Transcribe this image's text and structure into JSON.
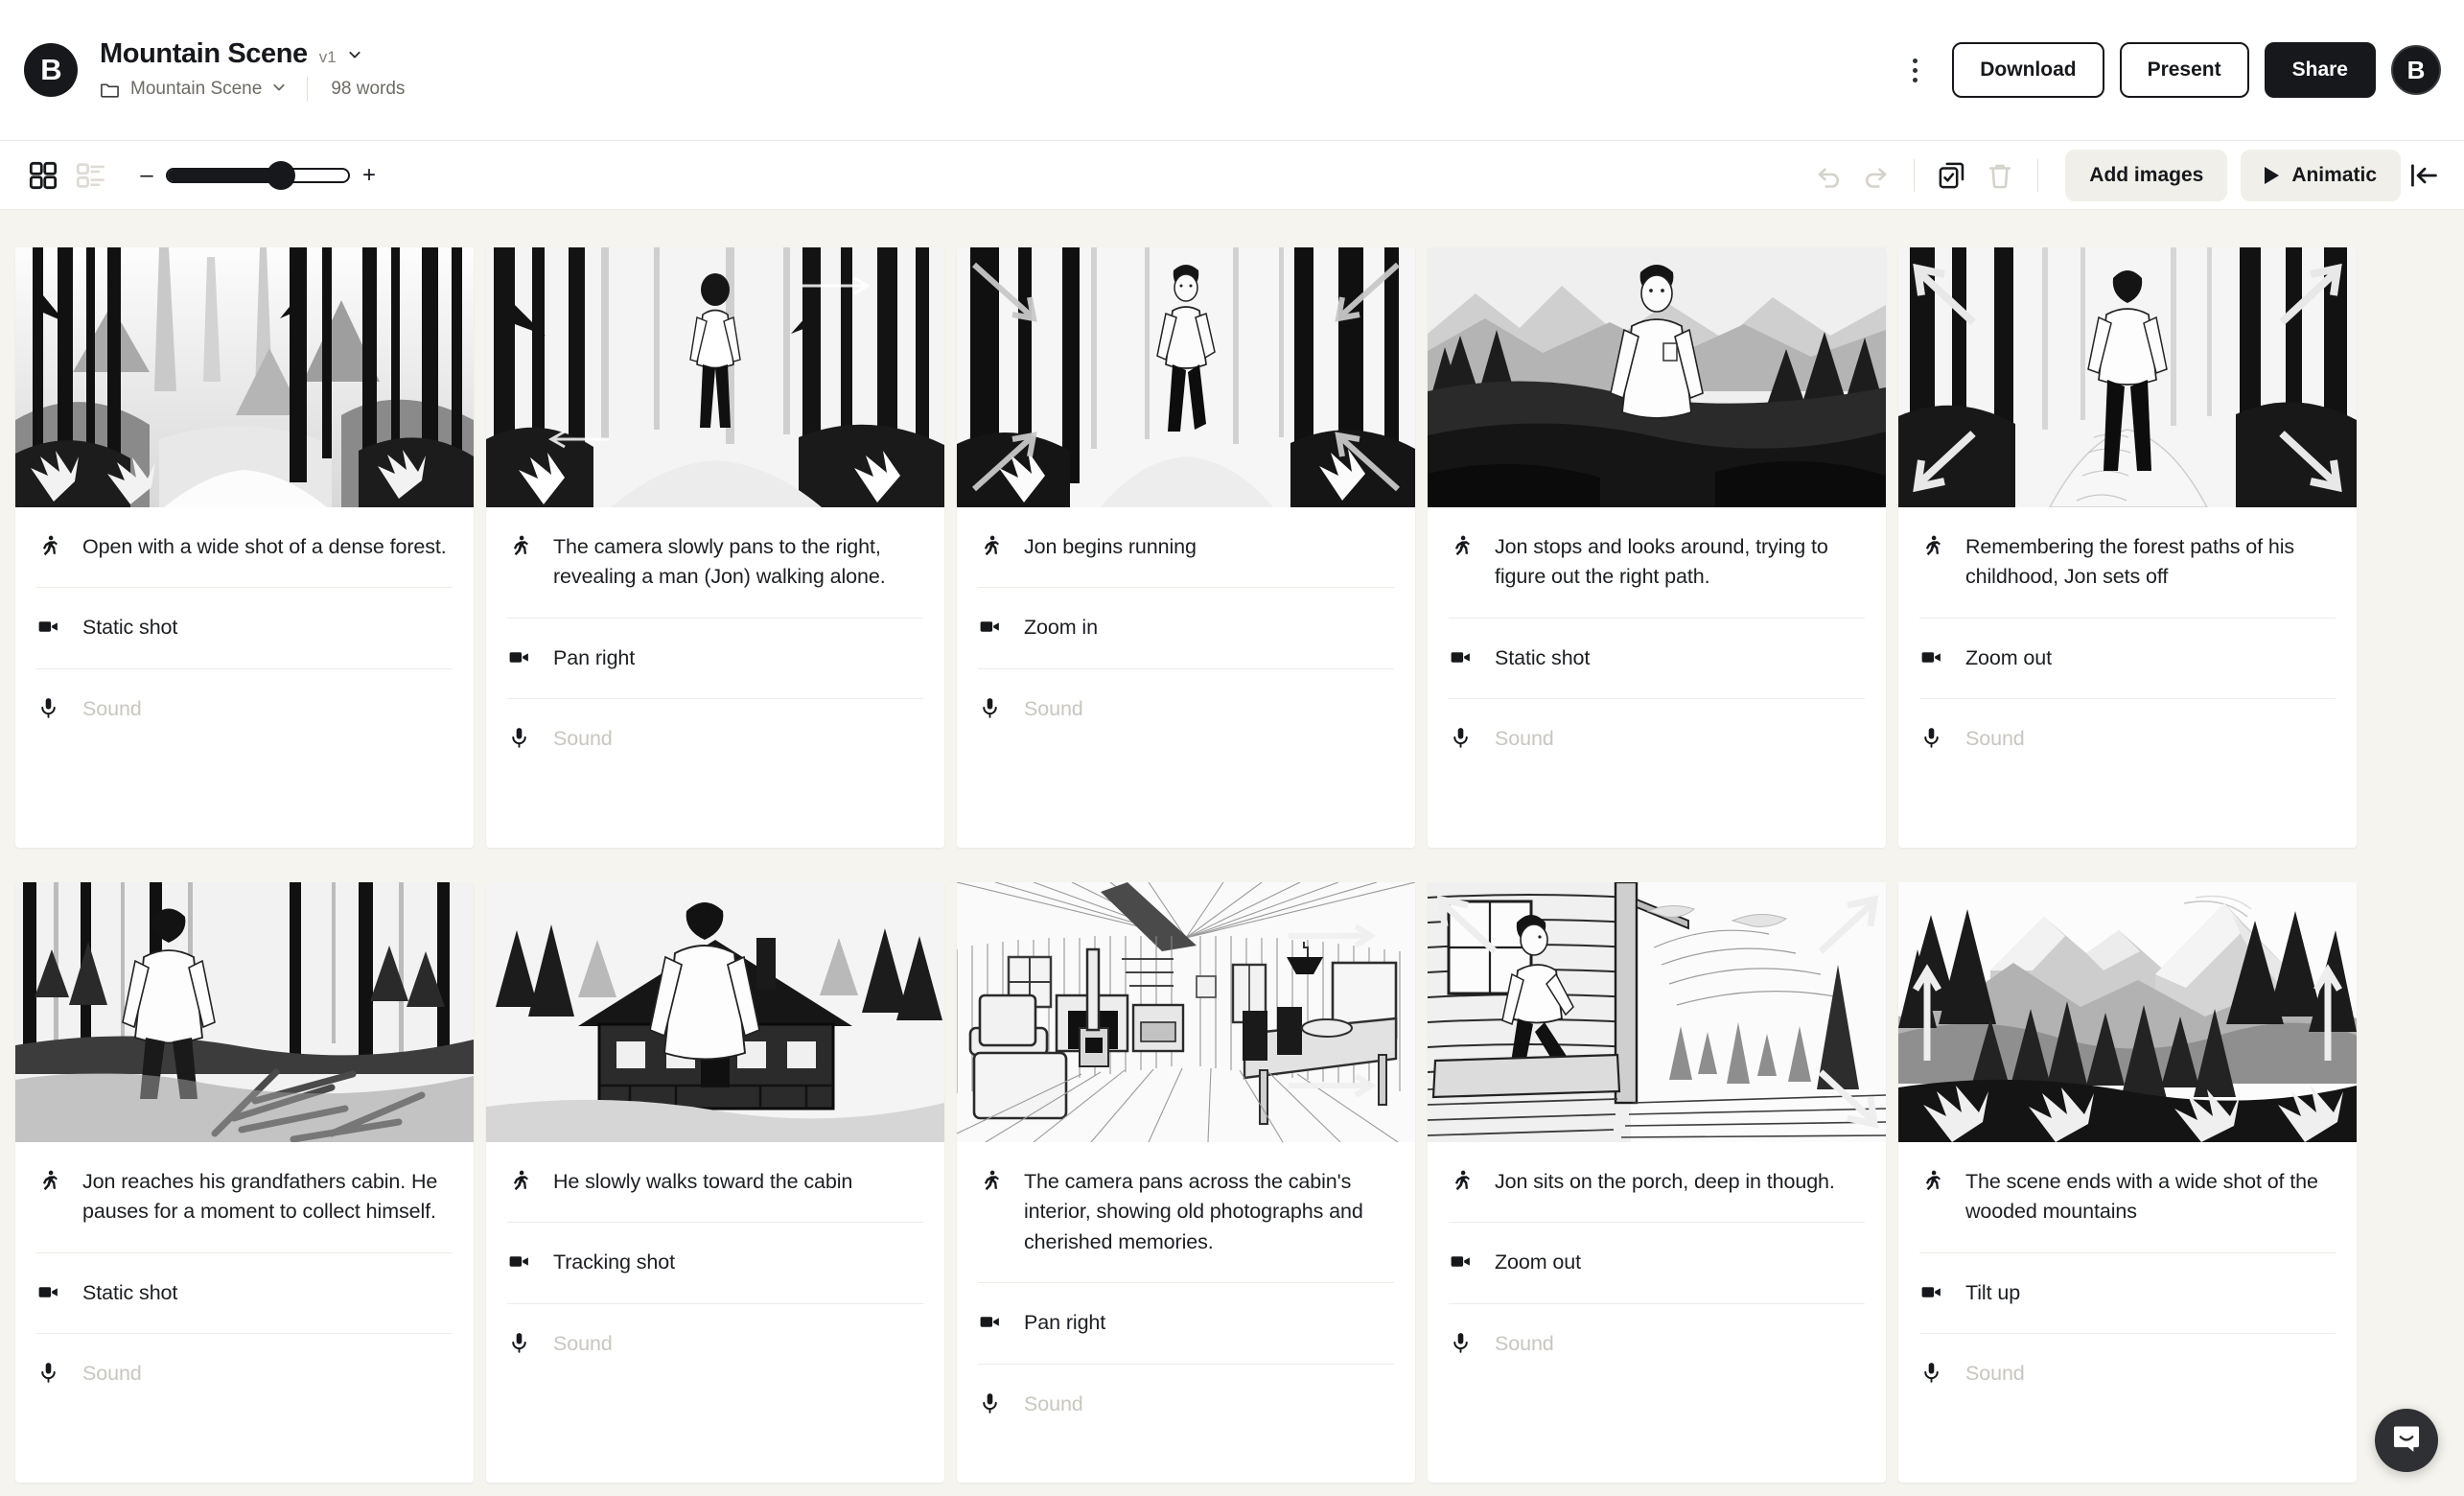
{
  "header": {
    "logo_letter": "B",
    "title": "Mountain Scene",
    "version": "v1",
    "folder_name": "Mountain Scene",
    "word_count": "98 words",
    "buttons": {
      "download": "Download",
      "present": "Present",
      "share": "Share"
    },
    "avatar_letter": "B",
    "icons": {
      "kebab": "more-vertical-icon",
      "folder": "folder-icon",
      "title_caret": "chevron-down-icon",
      "folder_caret": "chevron-down-icon"
    }
  },
  "toolbar": {
    "minus": "–",
    "plus": "+",
    "zoom_percent": 63,
    "add_images": "Add images",
    "animatic": "Animatic",
    "icons": {
      "grid_view": "grid-view-icon",
      "list_view": "list-view-icon",
      "undo": "undo-icon",
      "redo": "redo-icon",
      "select": "select-all-icon",
      "delete": "trash-icon",
      "play": "play-icon",
      "collapse": "collapse-panel-icon"
    }
  },
  "field_icons": {
    "action": "running-person-icon",
    "shot": "video-camera-icon",
    "sound": "microphone-icon"
  },
  "sound_placeholder": "Sound",
  "frames": [
    {
      "thumb": "forest-wide-shot",
      "action": "Open with a wide shot of a dense forest.",
      "shot": "Static shot",
      "sound": ""
    },
    {
      "thumb": "man-walking-forest-pan-right",
      "action": "The camera slowly pans to the right, revealing a man (Jon) walking alone.",
      "shot": "Pan right",
      "sound": ""
    },
    {
      "thumb": "jon-running-zoom-in",
      "action": "Jon begins running",
      "shot": "Zoom in",
      "sound": ""
    },
    {
      "thumb": "jon-stopped-looking-around",
      "action": "Jon stops and looks around, trying to figure out the right path.",
      "shot": "Static shot",
      "sound": ""
    },
    {
      "thumb": "jon-walking-away-zoom-out",
      "action": "Remembering the forest paths of his childhood, Jon sets off",
      "shot": "Zoom out",
      "sound": ""
    },
    {
      "thumb": "jon-at-ruined-cabin",
      "action": "Jon reaches his grandfathers cabin. He pauses for a moment to collect himself.",
      "shot": "Static shot",
      "sound": ""
    },
    {
      "thumb": "jon-approaching-cabin-tracking",
      "action": "He slowly walks toward the cabin",
      "shot": "Tracking shot",
      "sound": ""
    },
    {
      "thumb": "cabin-interior-pan-right",
      "action": "The camera pans across the cabin's interior, showing old photographs and cherished memories.",
      "shot": "Pan right",
      "sound": ""
    },
    {
      "thumb": "jon-on-porch-zoom-out",
      "action": "Jon sits on the porch, deep in though.",
      "shot": "Zoom out",
      "sound": ""
    },
    {
      "thumb": "wooded-mountains-tilt-up",
      "action": "The scene ends with a wide shot of the wooded mountains",
      "shot": "Tilt up",
      "sound": ""
    }
  ],
  "chat": {
    "icon": "chat-bubble-icon"
  },
  "colors": {
    "page_bg": "#f5f4ef",
    "card_bg": "#ffffff",
    "ink": "#16181c",
    "muted": "#85827b",
    "placeholder": "#c8c6bf"
  }
}
